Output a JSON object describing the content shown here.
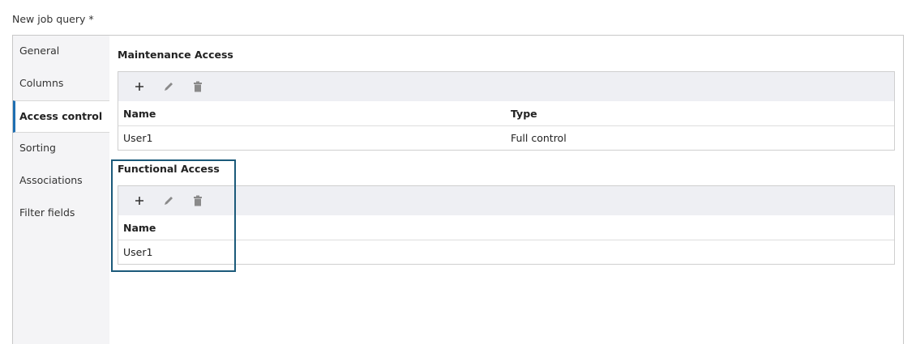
{
  "page": {
    "title": "New job query *"
  },
  "sidebar": {
    "items": [
      {
        "label": "General"
      },
      {
        "label": "Columns"
      },
      {
        "label": "Access control"
      },
      {
        "label": "Sorting"
      },
      {
        "label": "Associations"
      },
      {
        "label": "Filter fields"
      }
    ]
  },
  "maintenance": {
    "title": "Maintenance Access",
    "columns": {
      "name": "Name",
      "type": "Type"
    },
    "rows": [
      {
        "name": "User1",
        "type": "Full control"
      }
    ]
  },
  "functional": {
    "title": "Functional Access",
    "columns": {
      "name": "Name"
    },
    "rows": [
      {
        "name": "User1"
      }
    ]
  },
  "toolbar": {
    "icons": [
      "plus-icon",
      "pencil-icon",
      "trash-icon"
    ]
  },
  "colors": {
    "accent": "#1f6fb2",
    "highlight": "#1b5a7a",
    "toolbar_bg": "#eeeff3",
    "sidebar_bg": "#f4f4f6"
  }
}
